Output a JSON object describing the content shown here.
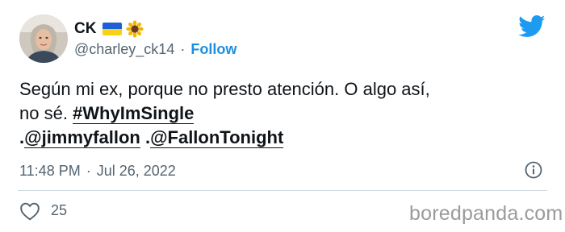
{
  "author": {
    "display_name": "CK",
    "flag_icon": "ukraine-flag-icon",
    "emoji_icon": "sunflower-icon",
    "handle": "@charley_ck14",
    "separator": "·",
    "follow_label": "Follow"
  },
  "tweet": {
    "line1": "Según mi ex, porque no presto atención. O algo así,",
    "line2_text": "no sé. ",
    "hashtag": "#WhyImSingle",
    "line3_prefix1": ".",
    "mention1": "@jimmyfallon",
    "line3_prefix2": " .",
    "mention2": "@FallonTonight"
  },
  "meta": {
    "time": "11:48 PM",
    "dot": "·",
    "date": "Jul 26, 2022"
  },
  "actions": {
    "like_count": "25"
  },
  "watermark": "boredpanda.com",
  "colors": {
    "accent": "#1d9bf0",
    "muted": "#536471",
    "text": "#0f1419",
    "divider": "#cfd9de"
  }
}
